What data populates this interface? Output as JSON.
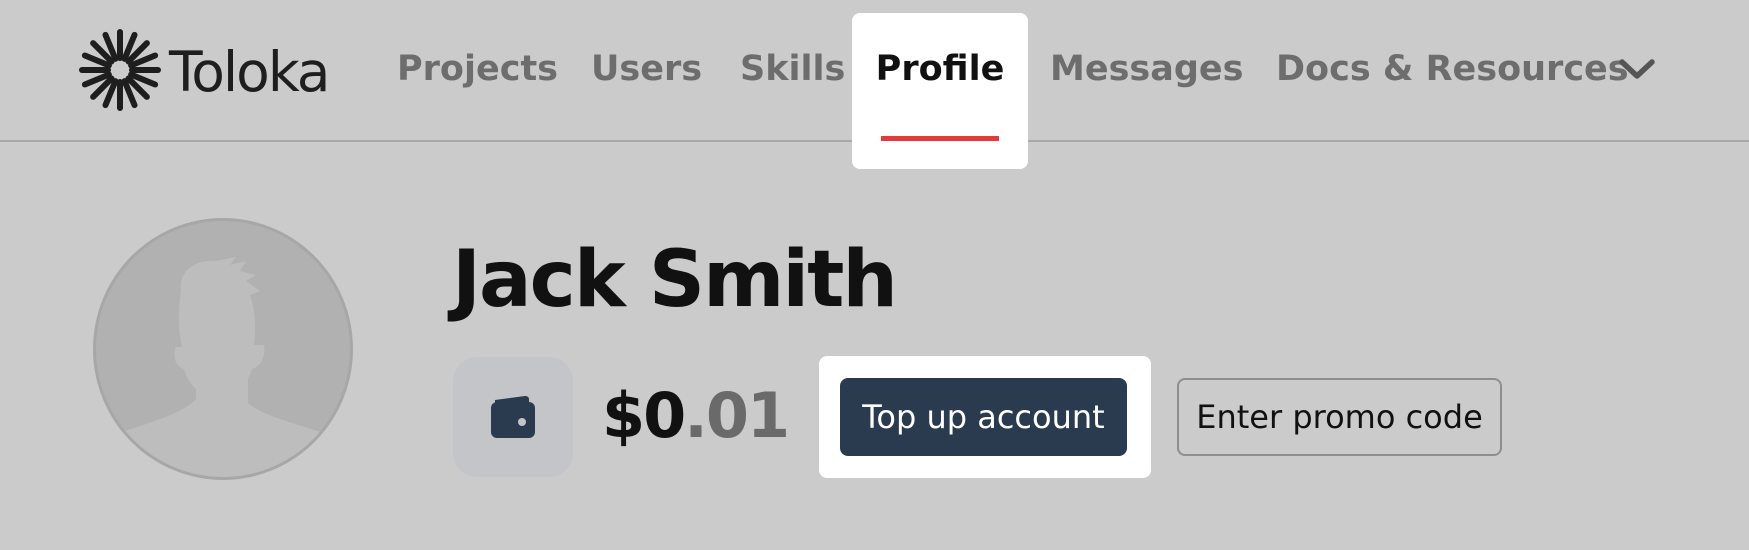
{
  "app": {
    "logo_text": "Toloka",
    "logo_icon": "toloka-sunburst-icon"
  },
  "nav": {
    "items": [
      {
        "label": "Projects",
        "active": false
      },
      {
        "label": "Users",
        "active": false
      },
      {
        "label": "Skills",
        "active": false
      },
      {
        "label": "Profile",
        "active": true
      },
      {
        "label": "Messages",
        "active": false
      },
      {
        "label": "Docs & Resources",
        "active": false
      }
    ],
    "more_icon": "chevron-down-icon",
    "active_underline_color": "#e63a3a"
  },
  "profile": {
    "name": "Jack Smith",
    "avatar_icon": "default-user-silhouette-icon",
    "wallet_icon": "wallet-icon",
    "balance": {
      "currency_and_whole": "$0",
      "fraction": ".01"
    },
    "top_up_label": "Top up account",
    "promo_label": "Enter promo code"
  },
  "colors": {
    "page_background": "#cbcbcb",
    "primary_button": "#2a3a4f",
    "highlight": "#ffffff"
  }
}
